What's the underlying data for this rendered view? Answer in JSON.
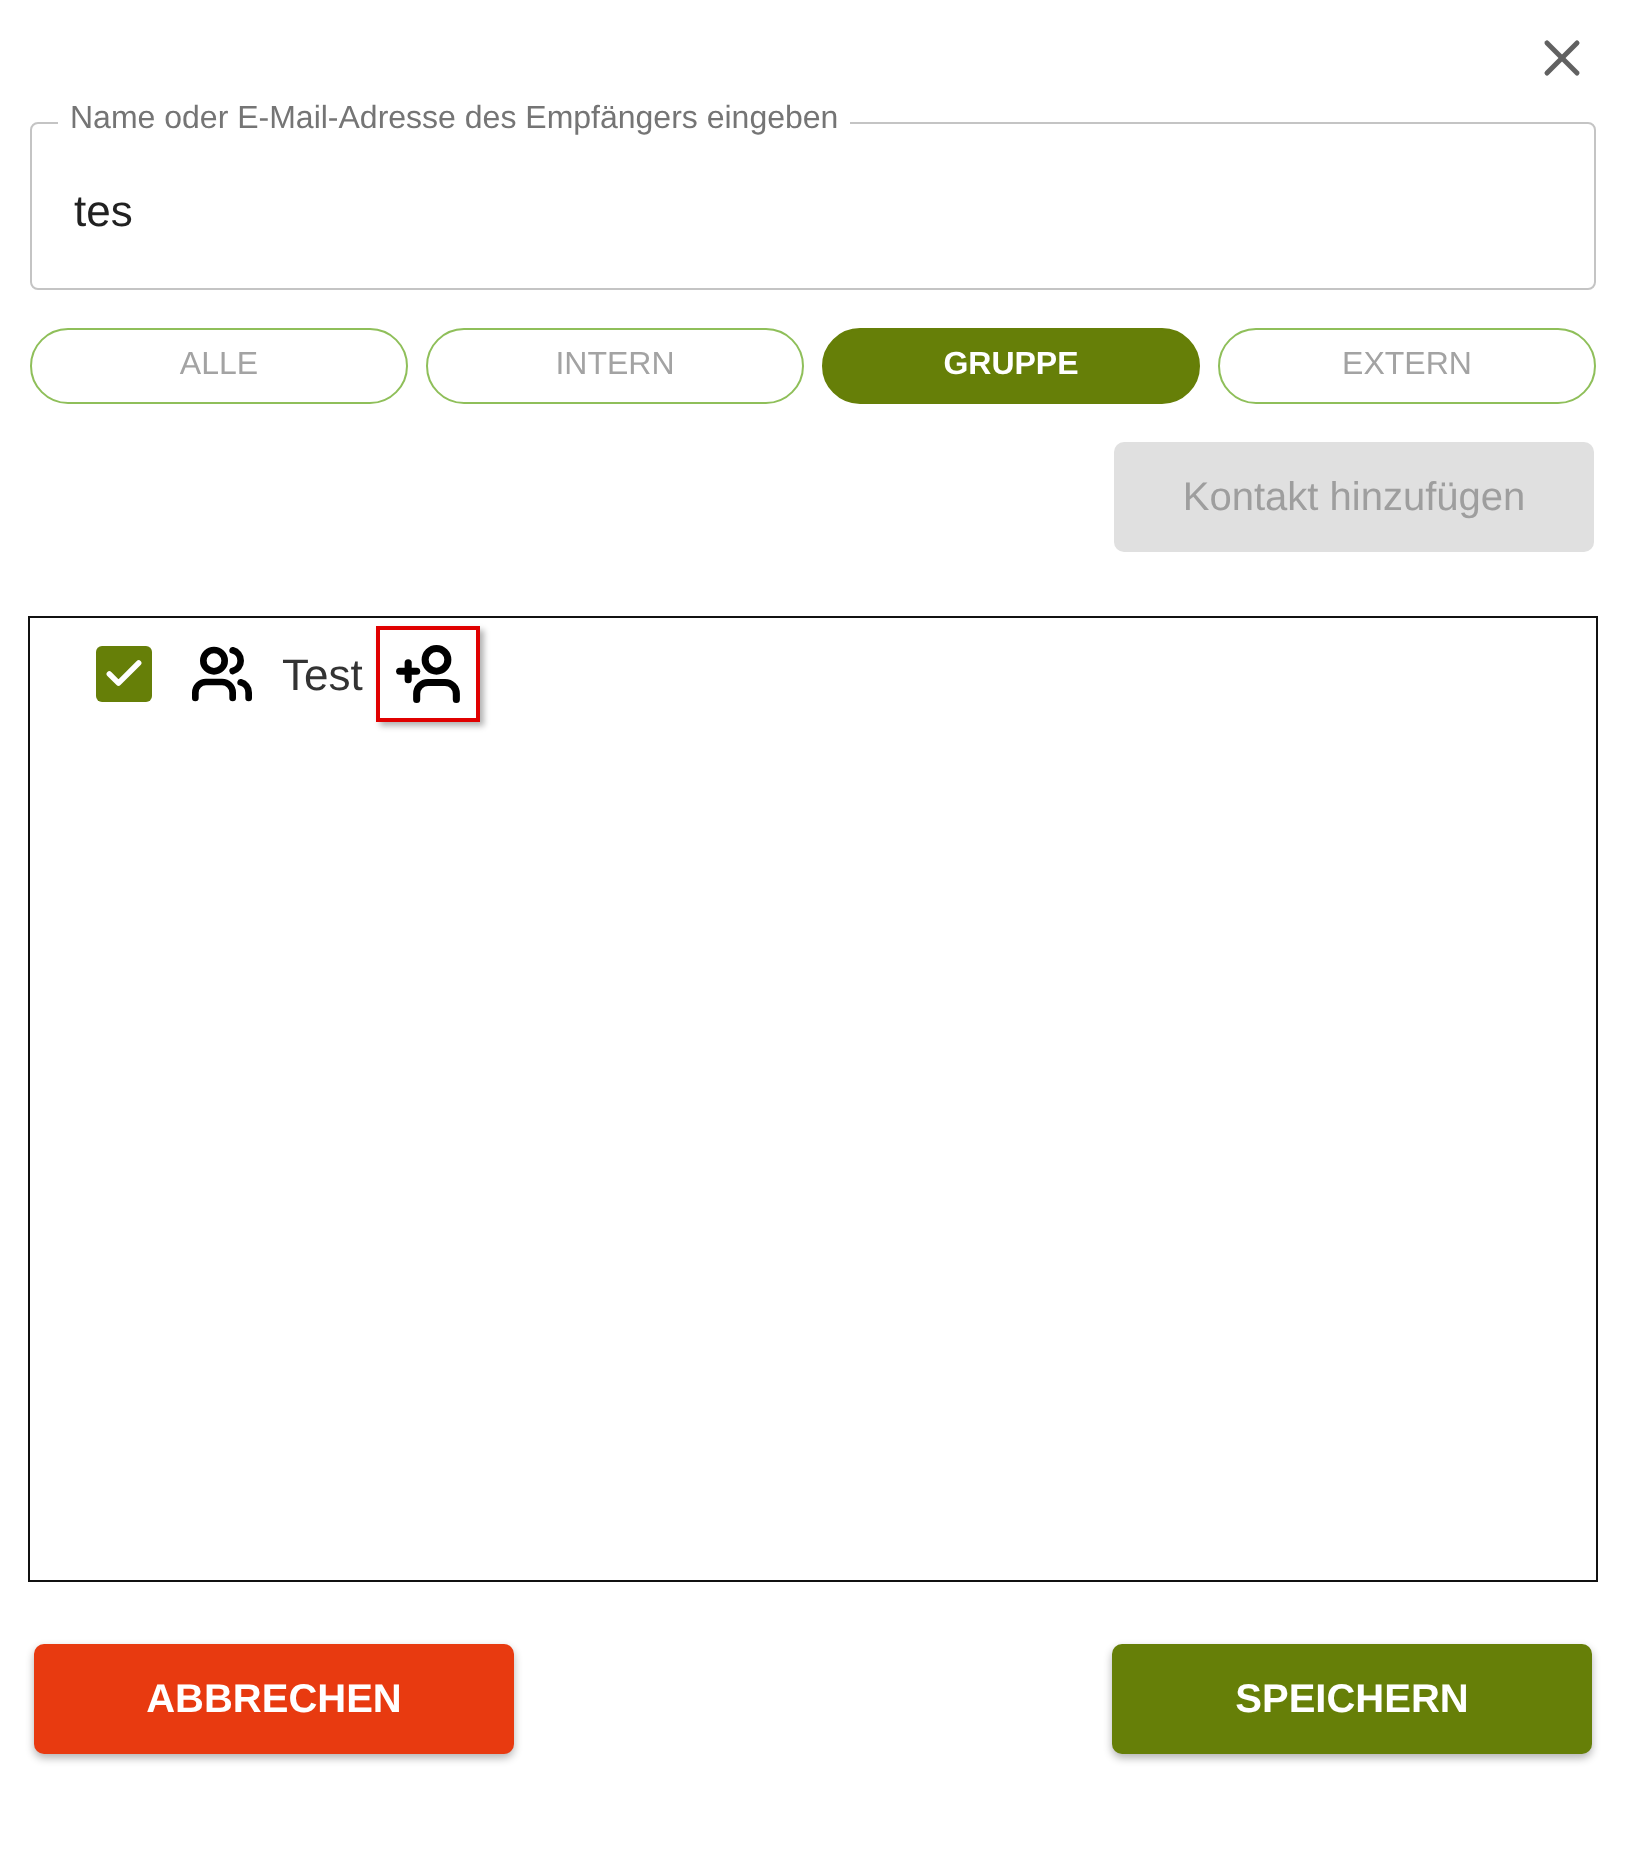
{
  "recipient_field": {
    "label": "Name oder E-Mail-Adresse des Empfängers eingeben",
    "value": "tes"
  },
  "filters": [
    {
      "label": "ALLE",
      "selected": false
    },
    {
      "label": "INTERN",
      "selected": false
    },
    {
      "label": "GRUPPE",
      "selected": true
    },
    {
      "label": "EXTERN",
      "selected": false
    }
  ],
  "add_contact_button": {
    "label": "Kontakt hinzufügen",
    "disabled": true
  },
  "results": [
    {
      "label": "Test",
      "kind": "group",
      "checked": true,
      "highlighted": true
    }
  ],
  "buttons": {
    "cancel": "ABBRECHEN",
    "save": "SPEICHERN"
  }
}
